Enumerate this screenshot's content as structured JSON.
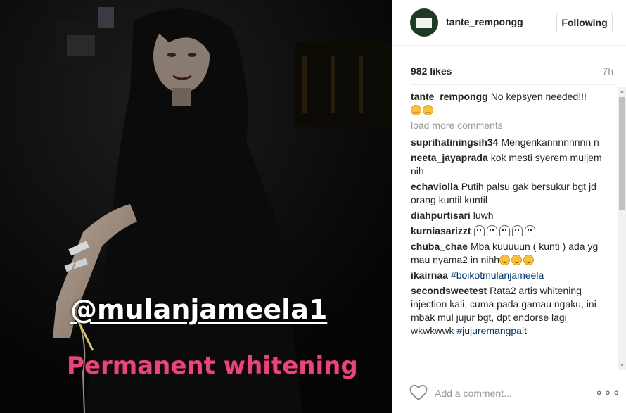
{
  "post": {
    "media": {
      "overlay_handle": "@mulanjameela1",
      "overlay_text": "Permanent whitening"
    },
    "author": {
      "username": "tante_rempongg",
      "follow_label": "Following"
    },
    "likes": "982 likes",
    "time_ago": "7h",
    "caption": {
      "username": "tante_rempongg",
      "text": "No kepsyen needed!!!"
    },
    "load_more_label": "load more comments",
    "comments": [
      {
        "username": "suprihatiningsih34",
        "text": "Mengerikannnnnnnn n"
      },
      {
        "username": "neeta_jayaprada",
        "text": "kok mesti syerem muljem nih"
      },
      {
        "username": "echaviolla",
        "text": "Putih palsu gak bersukur bgt jd orang kuntil kuntil"
      },
      {
        "username": "diahpurtisari",
        "text": "luwh"
      },
      {
        "username": "kurniasarizzt",
        "text": ""
      },
      {
        "username": "chuba_chae",
        "text": "Mba kuuuuun ( kunti ) ada yg mau nyama2 in nihh"
      },
      {
        "username": "ikairnaa",
        "text": "#boikotmulanjameela"
      },
      {
        "username": "secondsweetest",
        "text": "Rata2 artis whitening injection kali, cuma pada gamau ngaku, ini mbak mul jujur bgt, dpt endorse lagi wkwkwwk",
        "tag": "#jujuremangpait"
      }
    ],
    "comment_box": {
      "placeholder": "Add a comment...",
      "more_label": "∘∘∘"
    }
  },
  "icons": {
    "heart": "heart-outline",
    "more": "ellipsis-horizontal",
    "emoji_smile": "smiling-face",
    "emoji_ghost": "ghost"
  },
  "colors": {
    "overlay_text": "#e8467a",
    "link": "#003569",
    "muted": "#999999",
    "border": "#efefef"
  }
}
